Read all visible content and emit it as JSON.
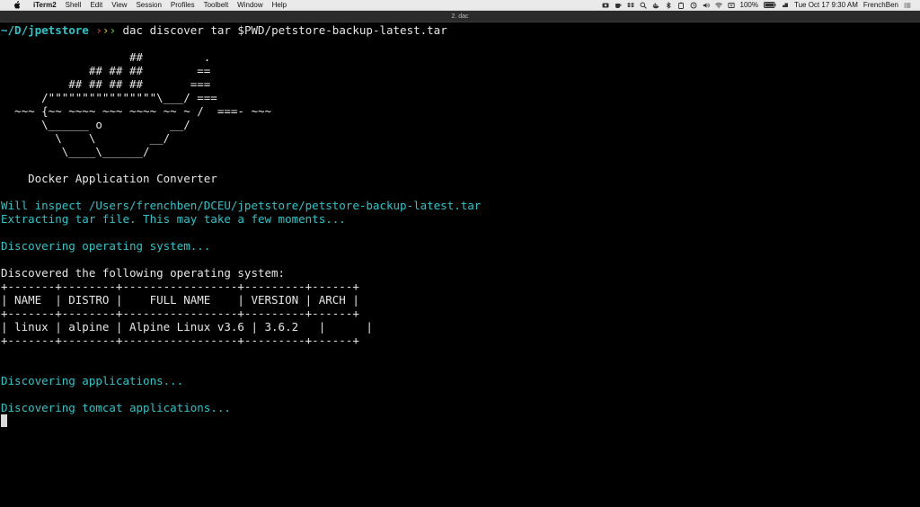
{
  "menubar": {
    "app_name": "iTerm2",
    "items": [
      "Shell",
      "Edit",
      "View",
      "Session",
      "Profiles",
      "Toolbelt",
      "Window",
      "Help"
    ],
    "status": {
      "battery": "100%",
      "datetime": "Tue Oct 17  9:30 AM",
      "user": "FrenchBen"
    }
  },
  "window": {
    "title": "2. dac"
  },
  "terminal": {
    "prompt": {
      "path": "~/D/jpetstore",
      "arrows": [
        "›",
        "›",
        "›"
      ],
      "command": "dac discover tar $PWD/petstore-backup-latest.tar"
    },
    "banner": [
      "                   ##         .",
      "             ## ## ##        ==",
      "          ## ## ## ##       ===",
      "      /\"\"\"\"\"\"\"\"\"\"\"\"\"\"\"\"\\___/ ===",
      "  ~~~ {~~ ~~~~ ~~~ ~~~~ ~~ ~ /  ===- ~~~",
      "      \\______ o          __/",
      "        \\    \\        __/",
      "         \\____\\______/",
      "",
      "    Docker Application Converter"
    ],
    "messages": {
      "inspect": "Will inspect /Users/frenchben/DCEU/jpetstore/petstore-backup-latest.tar",
      "extract": "Extracting tar file. This may take a few moments...",
      "discover_os": "Discovering operating system...",
      "discovered_os": "Discovered the following operating system:",
      "discover_apps": "Discovering applications...",
      "discover_tomcat": "Discovering tomcat applications..."
    },
    "table": {
      "border": "+-------+--------+-----------------+---------+------+",
      "header": "| NAME  | DISTRO |    FULL NAME    | VERSION | ARCH |",
      "row": "| linux | alpine | Alpine Linux v3.6 | 3.6.2   |      |",
      "columns": [
        "NAME",
        "DISTRO",
        "FULL NAME",
        "VERSION",
        "ARCH"
      ],
      "rows": [
        [
          "linux",
          "alpine",
          "Alpine Linux v3.6",
          "3.6.2",
          ""
        ]
      ]
    }
  },
  "colors": {
    "cyan": "#2ec4c6",
    "text": "#e6e6e6",
    "background": "#000000",
    "arrow_red": "#e0463b",
    "arrow_yellow": "#e5c43b",
    "arrow_green": "#5fce5a"
  }
}
